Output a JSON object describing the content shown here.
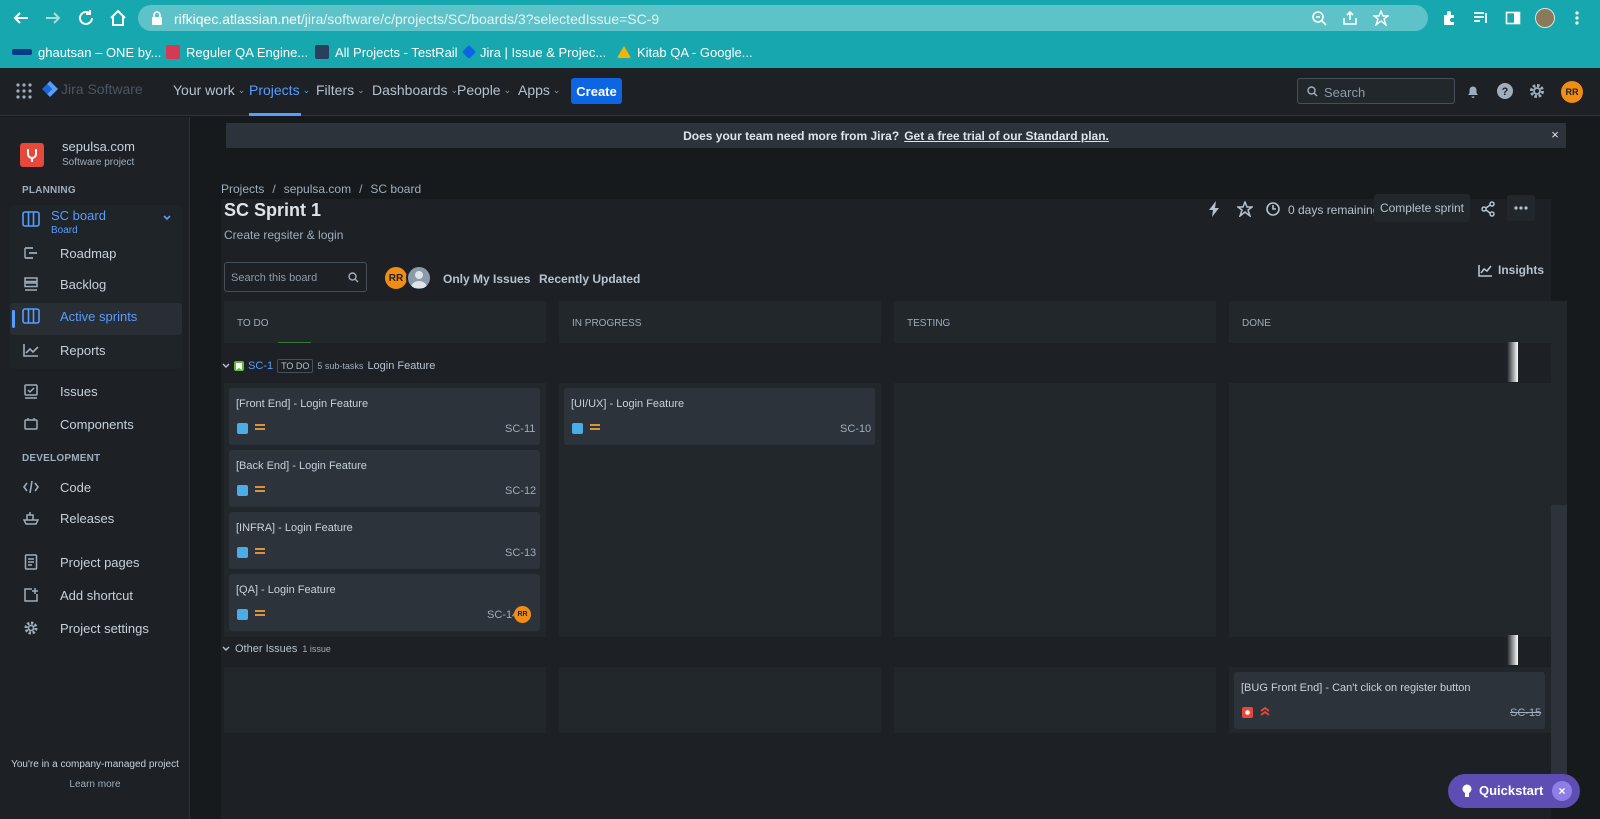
{
  "browser": {
    "url_host": "rifkiqec.atlassian.net",
    "url_path": "/jira/software/c/projects/SC/boards/3?selectedIssue=SC-9",
    "bookmarks": [
      {
        "label": "ghautsan – ONE by..."
      },
      {
        "label": "Reguler QA Engine..."
      },
      {
        "label": "All Projects - TestRail"
      },
      {
        "label": "Jira | Issue & Projec..."
      },
      {
        "label": "Kitab QA - Google..."
      }
    ]
  },
  "topbar": {
    "product": "Jira Software",
    "nav": [
      {
        "label": "Your work"
      },
      {
        "label": "Projects"
      },
      {
        "label": "Filters"
      },
      {
        "label": "Dashboards"
      },
      {
        "label": "People"
      },
      {
        "label": "Apps"
      }
    ],
    "create_label": "Create",
    "search_placeholder": "Search",
    "avatar_initials": "RR"
  },
  "sidebar": {
    "project_name": "sepulsa.com",
    "project_type": "Software project",
    "planning_heading": "PLANNING",
    "board_name": "SC board",
    "board_sub": "Board",
    "planning_items": [
      {
        "label": "Roadmap"
      },
      {
        "label": "Backlog"
      },
      {
        "label": "Active sprints"
      },
      {
        "label": "Reports"
      }
    ],
    "other_items": [
      {
        "label": "Issues"
      },
      {
        "label": "Components"
      }
    ],
    "development_heading": "DEVELOPMENT",
    "development_items": [
      {
        "label": "Code"
      },
      {
        "label": "Releases"
      }
    ],
    "bottom_items": [
      {
        "label": "Project pages"
      },
      {
        "label": "Add shortcut"
      },
      {
        "label": "Project settings"
      }
    ],
    "company_note": "You're in a company-managed project",
    "learn_more": "Learn more"
  },
  "banner": {
    "text": "Does your team need more from Jira?",
    "link": "Get a free trial of our Standard plan.",
    "close": "×"
  },
  "breadcrumb": [
    "Projects",
    "sepulsa.com",
    "SC board"
  ],
  "sprint": {
    "title": "SC Sprint 1",
    "goal": "Create regsiter & login",
    "days_remaining": "0 days remaining",
    "complete_label": "Complete sprint"
  },
  "toolbar": {
    "search_placeholder": "Search this board",
    "avatar_initials": "RR",
    "only_my_issues": "Only My Issues",
    "recently_updated": "Recently Updated",
    "insights": "Insights"
  },
  "columns": [
    {
      "title": "TO DO"
    },
    {
      "title": "IN PROGRESS"
    },
    {
      "title": "TESTING"
    },
    {
      "title": "DONE"
    }
  ],
  "swimlane_sc1": {
    "key": "SC-1",
    "status": "TO DO",
    "subtasks": "5 sub-tasks",
    "summary": "Login Feature",
    "todo_cards": [
      {
        "summary": "[Front End] - Login Feature",
        "key": "SC-11"
      },
      {
        "summary": "[Back End] - Login Feature",
        "key": "SC-12"
      },
      {
        "summary": "[INFRA] - Login Feature",
        "key": "SC-13"
      },
      {
        "summary": "[QA] - Login Feature",
        "key": "SC-14",
        "assignee": "RR"
      }
    ],
    "inprogress_cards": [
      {
        "summary": "[UI/UX] - Login Feature",
        "key": "SC-10"
      }
    ]
  },
  "swimlane_other": {
    "label": "Other Issues",
    "count": "1 issue",
    "done_cards": [
      {
        "summary": "[BUG Front End] - Can't click on register button",
        "key": "SC-15"
      }
    ]
  },
  "quickstart": {
    "label": "Quickstart",
    "close": "×"
  },
  "colors": {
    "accent": "#579dff",
    "create": "#0c66e4",
    "browser": "#17a7ae",
    "quickstart": "#5e4db2",
    "avatar": "#f18d13"
  }
}
